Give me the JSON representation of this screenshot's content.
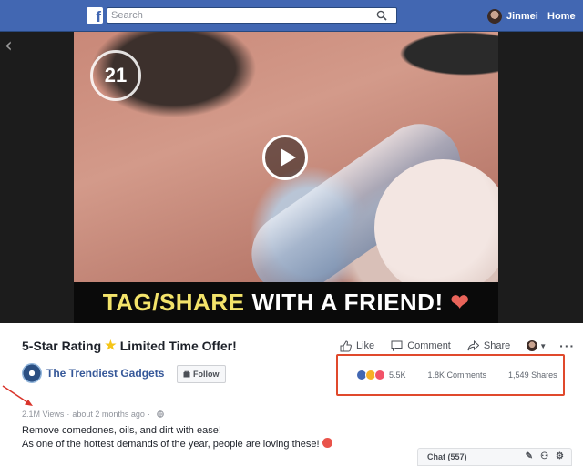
{
  "header": {
    "search_placeholder": "Search",
    "logo_letter": "f",
    "user_name": "Jinmei",
    "home_label": "Home"
  },
  "video": {
    "channel_logo": "21",
    "caption_yellow": "TAG/SHARE",
    "caption_white": "WITH A FRIEND!",
    "caption_heart": "❤"
  },
  "post": {
    "title_part1": "5-Star Rating",
    "title_star": "★",
    "title_part2": "Limited Time Offer!",
    "actions": {
      "like": "Like",
      "comment": "Comment",
      "share": "Share"
    },
    "page_name": "The Trendiest Gadgets",
    "follow_label": "Follow",
    "stats": {
      "reactions": "5.5K",
      "comments": "1.8K Comments",
      "shares": "1,549 Shares"
    },
    "meta": {
      "views": "2.1M Views",
      "time": "about 2 months ago"
    },
    "description_line1": "Remove comedones, oils, and dirt with ease!",
    "description_line2": "As one of the hottest demands of the year, people are loving these!"
  },
  "chat": {
    "label": "Chat (557)"
  },
  "colors": {
    "brand": "#4267b2",
    "highlight": "#e0492c",
    "link": "#365899"
  }
}
